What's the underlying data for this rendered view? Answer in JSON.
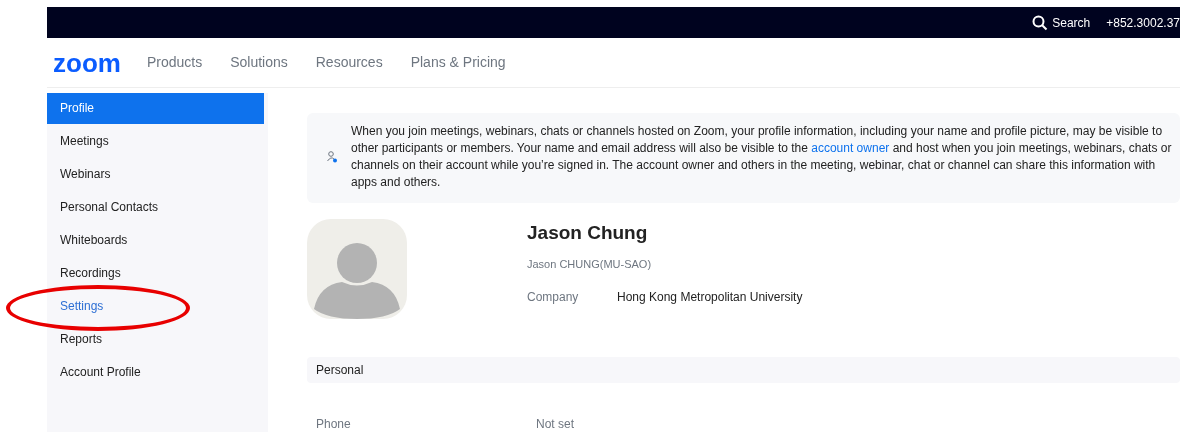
{
  "top_bar": {
    "search": "Search",
    "phone": "+852.3002.37"
  },
  "nav": {
    "logo": "zoom",
    "links": [
      "Products",
      "Solutions",
      "Resources",
      "Plans & Pricing"
    ]
  },
  "sidebar": {
    "items": [
      {
        "label": "Profile",
        "selected": true,
        "circled": false
      },
      {
        "label": "Meetings",
        "selected": false,
        "circled": false
      },
      {
        "label": "Webinars",
        "selected": false,
        "circled": false
      },
      {
        "label": "Personal Contacts",
        "selected": false,
        "circled": false
      },
      {
        "label": "Whiteboards",
        "selected": false,
        "circled": false
      },
      {
        "label": "Recordings",
        "selected": false,
        "circled": false
      },
      {
        "label": "Settings",
        "selected": false,
        "circled": true
      },
      {
        "label": "Reports",
        "selected": false,
        "circled": false
      },
      {
        "label": "Account Profile",
        "selected": false,
        "circled": false
      }
    ]
  },
  "notice": {
    "before": "When you join meetings, webinars, chats or channels hosted on Zoom, your profile information, including your name and profile picture, may be visible to other participants or members. Your name and email address will also be visible to the ",
    "link": "account owner",
    "after": " and host when you join meetings, webinars, chats or channels on their account while you’re signed in. The account owner and others in the meeting, webinar, chat or channel can share this information with apps and others."
  },
  "profile": {
    "name": "Jason Chung",
    "display_name": "Jason CHUNG(MU-SAO)",
    "fields": [
      {
        "label": "Company",
        "value": "Hong Kong Metropolitan University"
      }
    ]
  },
  "personal": {
    "title": "Personal",
    "fields": [
      {
        "label": "Phone",
        "value": "Not set"
      }
    ]
  }
}
